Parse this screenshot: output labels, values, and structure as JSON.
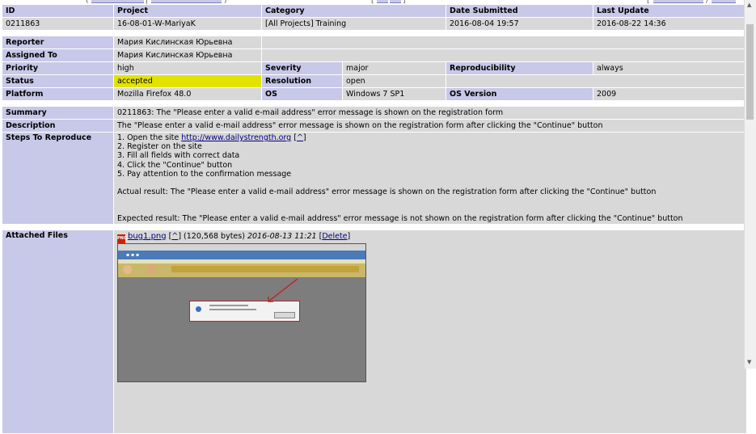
{
  "table": {
    "header": {
      "id": "ID",
      "project": "Project",
      "category": "Category",
      "date_submitted": "Date Submitted",
      "last_update": "Last Update"
    },
    "values": {
      "id": "0211863",
      "project": "16-08-01-W-MariyaK",
      "category": "[All Projects] Training",
      "date_submitted": "2016-08-04 19:57",
      "last_update": "2016-08-22 14:36"
    },
    "reporter": {
      "label": "Reporter",
      "value": "Мария Кислинская Юрьевна"
    },
    "assigned_to": {
      "label": "Assigned To",
      "value": "Мария Кислинская Юрьевна"
    },
    "priority": {
      "label": "Priority",
      "value": "high"
    },
    "severity": {
      "label": "Severity",
      "value": "major"
    },
    "reproducibility": {
      "label": "Reproducibility",
      "value": "always"
    },
    "status": {
      "label": "Status",
      "value": "accepted",
      "color": "#e3e300"
    },
    "resolution": {
      "label": "Resolution",
      "value": "open"
    },
    "platform": {
      "label": "Platform",
      "value": "Mozilla Firefox 48.0"
    },
    "os": {
      "label": "OS",
      "value": "Windows 7 SP1"
    },
    "os_version": {
      "label": "OS Version",
      "value": "2009"
    },
    "summary": {
      "label": "Summary",
      "value": "0211863: The \"Please enter a valid e-mail address\" error message is shown on the registration form"
    },
    "description": {
      "label": "Description",
      "value": "The \"Please enter a valid e-mail address\" error message is shown on the registration form after clicking the \"Continue\" button"
    },
    "steps": {
      "label": "Steps To Reproduce",
      "step1_prefix": "1. Open the site ",
      "step1_link": "http://www.dailystrength.org",
      "step1_suffix_link": "^",
      "rest": "2. Register on the site\n3. Fill all fields with correct data\n4. Click the \"Continue\" button\n5. Pay attention to the confirmation message",
      "actual": "Actual result: The \"Please enter a valid e-mail address\" error message is shown on the registration form after clicking the \"Continue\" button",
      "expected": "Expected result: The \"Please enter a valid e-mail address\" error message is not shown on the registration form after clicking the \"Continue\" button"
    },
    "attached": {
      "label": "Attached Files",
      "file_name": "bug1.png",
      "caret_link": "^",
      "size": "(120,568 bytes)",
      "date": "2016-08-13 11:21",
      "delete_label": "Delete"
    }
  },
  "colors": {
    "header_bg": "#c8c8e8",
    "cell_bg": "#d8d8d8",
    "status_accepted": "#e3e300",
    "link": "#000080"
  }
}
